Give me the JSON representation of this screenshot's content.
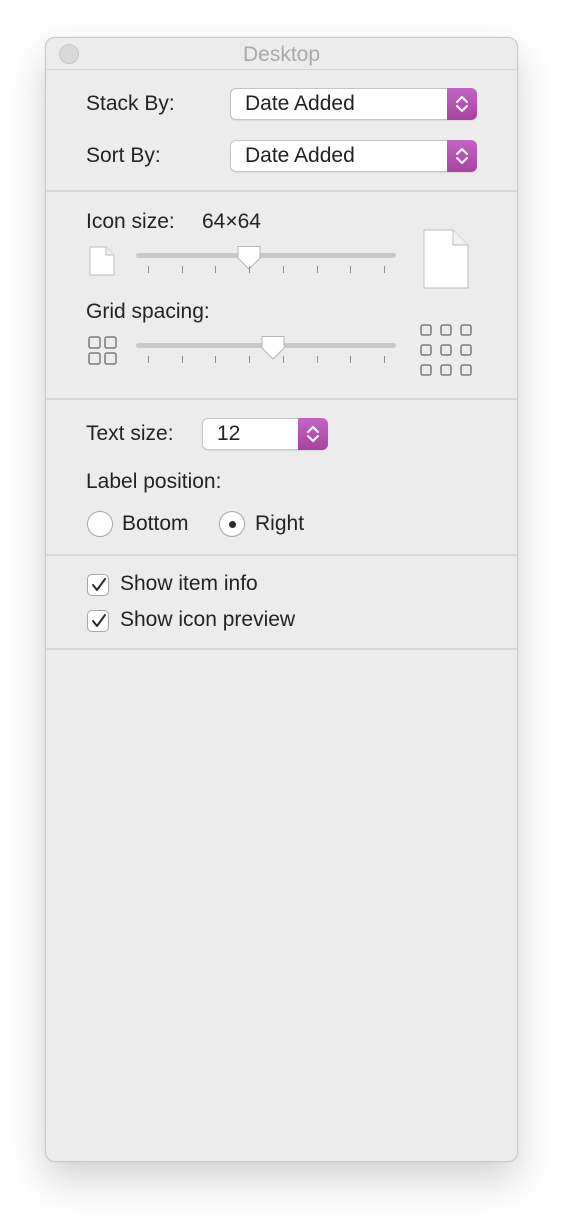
{
  "window": {
    "title": "Desktop"
  },
  "arrange": {
    "stack_by_label": "Stack By:",
    "stack_by_value": "Date Added",
    "sort_by_label": "Sort By:",
    "sort_by_value": "Date Added"
  },
  "icons": {
    "icon_size_label": "Icon size:",
    "icon_size_value": "64×64",
    "icon_size_level": 0.43,
    "grid_spacing_label": "Grid spacing:",
    "grid_spacing_level": 0.53
  },
  "text": {
    "text_size_label": "Text size:",
    "text_size_value": "12",
    "label_position_label": "Label position:",
    "option_bottom": "Bottom",
    "option_right": "Right",
    "selected_position": "Right"
  },
  "options": {
    "show_item_info": "Show item info",
    "show_item_info_checked": true,
    "show_icon_preview": "Show icon preview",
    "show_icon_preview_checked": true
  },
  "colors": {
    "accent": "#b352b0",
    "window_bg": "#ececec"
  }
}
